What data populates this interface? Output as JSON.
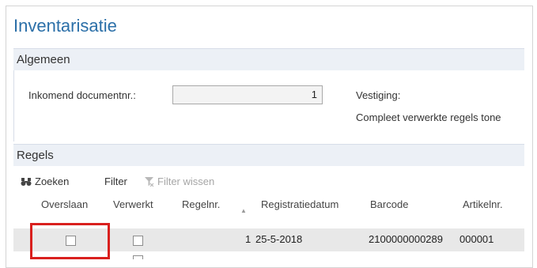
{
  "page": {
    "title": "Inventarisatie"
  },
  "general": {
    "header": "Algemeen",
    "doc_label": "Inkomend documentnr.:",
    "doc_value": "1",
    "branch_label": "Vestiging:",
    "show_completed_label": "Compleet verwerkte regels tone"
  },
  "lines": {
    "header": "Regels",
    "toolbar": {
      "search": "Zoeken",
      "filter": "Filter",
      "clear_filter": "Filter wissen"
    },
    "columns": {
      "skip": "Overslaan",
      "processed": "Verwerkt",
      "line_no": "Regelnr.",
      "reg_date": "Registratiedatum",
      "barcode": "Barcode",
      "item_no": "Artikelnr."
    },
    "rows": [
      {
        "line_no": "1",
        "reg_date": "25-5-2018",
        "barcode": "2100000000289",
        "item_no": "000001"
      }
    ]
  },
  "colors": {
    "accent": "#2b6fa8",
    "highlight": "#d9201e"
  },
  "icons": {
    "search": "binoculars-icon",
    "clear_filter": "filter-clear-icon"
  }
}
